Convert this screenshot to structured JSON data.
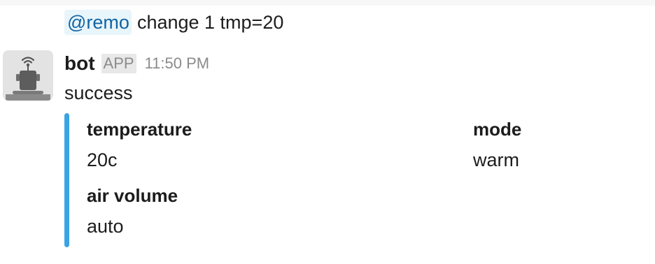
{
  "previous_message": {
    "mention": "@remo",
    "text": "change 1 tmp=20"
  },
  "message": {
    "sender": "bot",
    "badge": "APP",
    "timestamp": "11:50 PM",
    "avatar_icon": "robot-antenna-icon",
    "text": "success",
    "attachment": {
      "accent_color": "#3aa3e3",
      "fields": [
        {
          "title": "temperature",
          "value": "20c"
        },
        {
          "title": "mode",
          "value": "warm"
        },
        {
          "title": "air volume",
          "value": "auto"
        }
      ]
    }
  }
}
